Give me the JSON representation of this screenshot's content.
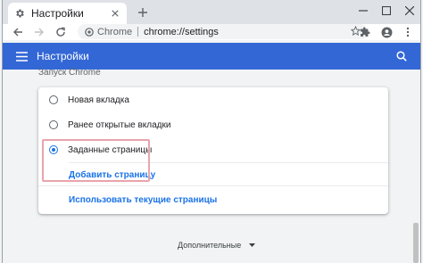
{
  "tab": {
    "title": "Настройки",
    "favicon": "gear-icon",
    "close": "close-icon"
  },
  "newtab_icon": "plus-icon",
  "window_controls": [
    "minimize-icon",
    "maximize-icon",
    "close-icon"
  ],
  "toolbar": {
    "chip_label": "Chrome",
    "url": "chrome://settings",
    "icons": [
      "back-icon",
      "forward-icon",
      "reload-icon",
      "star-icon",
      "puzzle-icon",
      "profile-icon",
      "more-icon"
    ]
  },
  "header": {
    "title": "Настройки",
    "menu_icon": "hamburger-icon",
    "search_icon": "search-icon",
    "color": "#3367d6"
  },
  "startup": {
    "section_label": "Запуск Chrome",
    "options": [
      {
        "label": "Новая вкладка",
        "selected": false
      },
      {
        "label": "Ранее открытые вкладки",
        "selected": false
      },
      {
        "label": "Заданные страницы",
        "selected": true
      }
    ],
    "add_page": "Добавить страницу",
    "use_current": "Использовать текущие страницы"
  },
  "advanced": {
    "label": "Дополнительные"
  },
  "accent": "#1a73e8",
  "highlight_color": "#e8a4ad"
}
